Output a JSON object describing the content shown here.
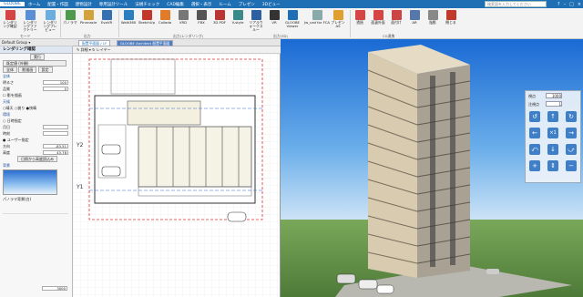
{
  "menubar": {
    "items": [
      "GLOOBE",
      "ホーム",
      "配置・作図",
      "建物設計",
      "専用設計ツール",
      "法規チェック",
      "CAD編集",
      "選択・表示",
      "ルーム",
      "プレゼン",
      "3Dビュー"
    ],
    "search_placeholder": "検索語を入力してください"
  },
  "ribbon": {
    "buttons": [
      "レンダリング確認",
      "レンダリングファクトリー",
      "レンダリングプレビュー",
      "パノラマ",
      "Pinnnacle",
      "EvaVR",
      "Walk360",
      "SketchUp",
      "Collada",
      "VRD",
      "FBX",
      "3D PDF",
      "V-style",
      "リアルウォークスルー",
      "VR",
      "GLOOBE Viewer",
      "Jw_cad for FCA",
      "プレゼンAS",
      "透過",
      "面裏外面",
      "面付け",
      "AR",
      "陰影",
      "閉じる"
    ],
    "groups": [
      "モード",
      "出力",
      "出力(レンダリング)",
      "出力(3D)",
      "CG連携"
    ]
  },
  "layerbar": {
    "text": "Default Group ▾"
  },
  "leftpanel": {
    "title": "レンダリング確認",
    "exec": "実行",
    "preset": "既定値 (外観)",
    "tabs": [
      "全体",
      "影描画",
      "設定"
    ],
    "section_all": "全体",
    "brightness_label": "明るさ",
    "brightness_value": "100",
    "contrast_label": "品質",
    "contrast_value": "0",
    "bg_check": "影を描画",
    "sky_label": "天候",
    "sky_options": [
      "晴天",
      "曇り",
      "快晴"
    ],
    "daylight_label": "環境",
    "sun_check": "日時指定",
    "date_label": "月日",
    "time_label": "時刻",
    "user_check": "ユーザー指定",
    "azimuth_label": "方向",
    "azimuth_value": "-83.51",
    "altitude_label": "高度",
    "altitude_value": "43.78",
    "sun_button": "日照から高度読込み",
    "bg_section": "背景",
    "bg_caption": "パノラマ背景(白)",
    "bottom_field": "3000"
  },
  "plan": {
    "tab_label": "配置平面図 / 1F",
    "tab_label2": "GLOOBE Architect 配置平面図",
    "tools": "✎ 詳細 ▾    ↻ レイヤー",
    "axis_labels": [
      "Y2",
      "Y1"
    ]
  },
  "view3d": {
    "nav_fields": [
      "1000",
      "1"
    ],
    "nav_labels": [
      "視点",
      "注視点"
    ]
  }
}
